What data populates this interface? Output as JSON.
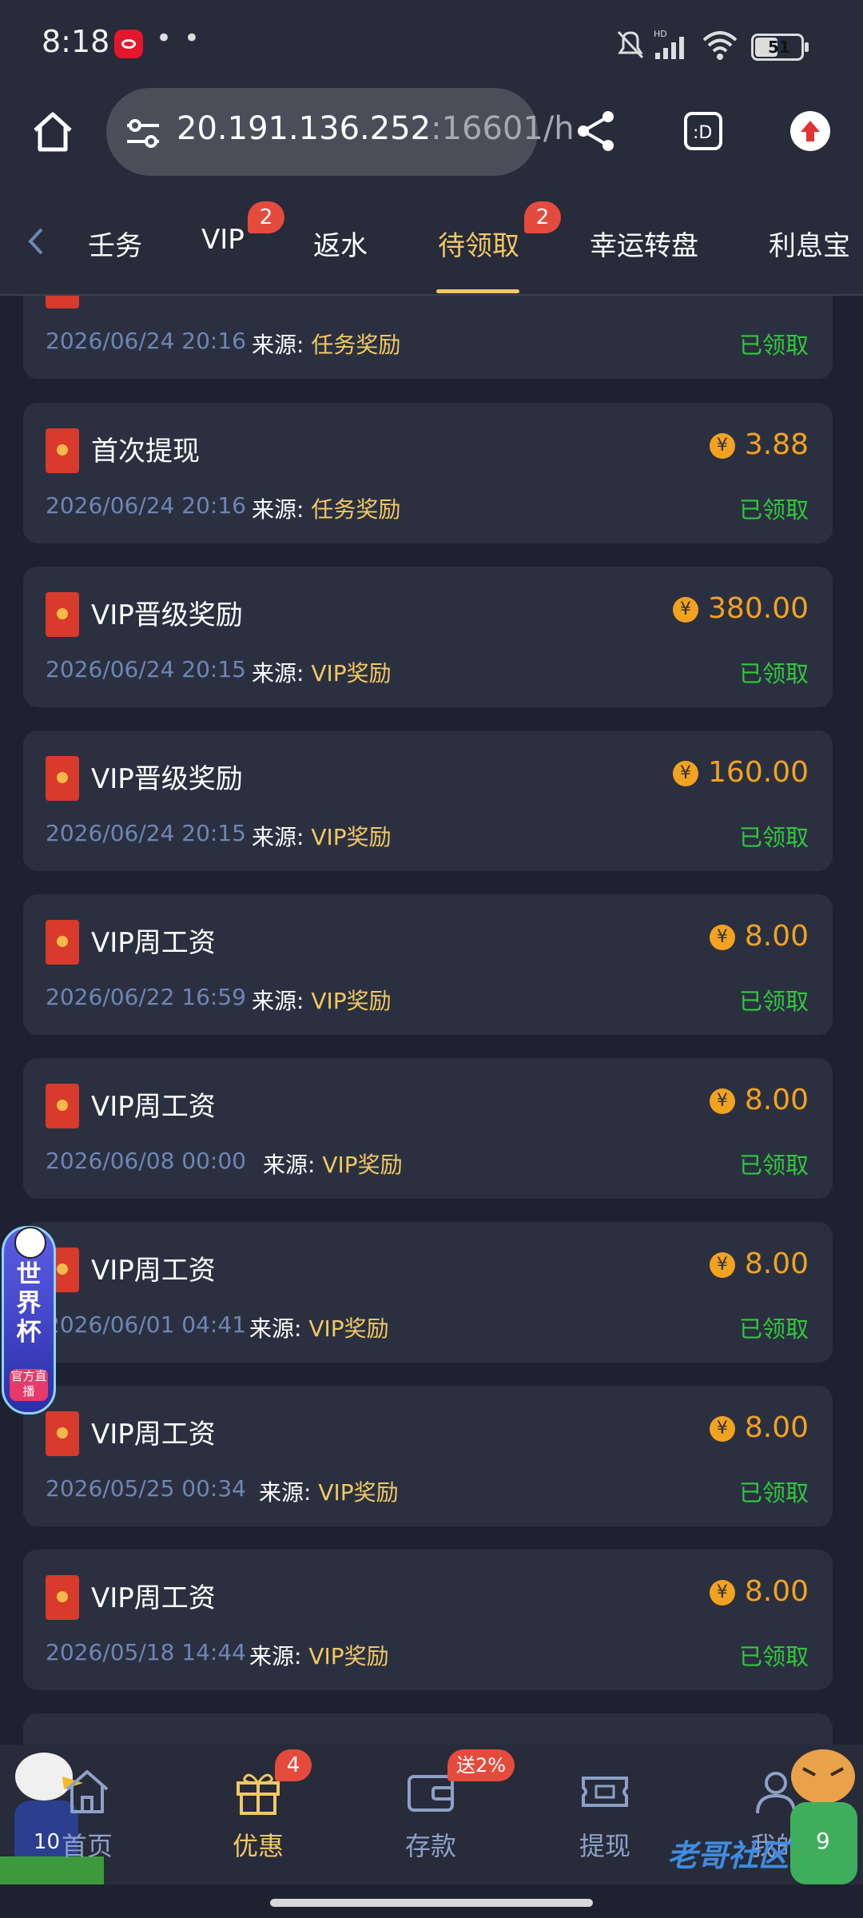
{
  "status_bar": {
    "time": "8:18",
    "battery": "51",
    "network": "HD"
  },
  "browser": {
    "url_host": "20.191.136.252",
    "url_rest": ":16601/h"
  },
  "tabs": [
    {
      "label": "任务",
      "display": "壬务"
    },
    {
      "label": "VIP",
      "badge": "2"
    },
    {
      "label": "返水"
    },
    {
      "label": "待领取",
      "badge": "2",
      "active": true
    },
    {
      "label": "幸运转盘"
    },
    {
      "label": "利息宝"
    }
  ],
  "records": [
    {
      "title": "",
      "amount": "",
      "date": "2026/06/24 20:16",
      "source_label": "来源:",
      "source": "任务奖励",
      "status": "已领取"
    },
    {
      "title": "首次提现",
      "amount": "3.88",
      "date": "2026/06/24 20:16",
      "source_label": "来源:",
      "source": "任务奖励",
      "status": "已领取"
    },
    {
      "title": "VIP晋级奖励",
      "amount": "380.00",
      "date": "2026/06/24 20:15",
      "source_label": "来源:",
      "source": "VIP奖励",
      "status": "已领取"
    },
    {
      "title": "VIP晋级奖励",
      "amount": "160.00",
      "date": "2026/06/24 20:15",
      "source_label": "来源:",
      "source": "VIP奖励",
      "status": "已领取"
    },
    {
      "title": "VIP周工资",
      "amount": "8.00",
      "date": "2026/06/22 16:59",
      "source_label": "来源:",
      "source": "VIP奖励",
      "status": "已领取"
    },
    {
      "title": "VIP周工资",
      "amount": "8.00",
      "date": "2026/06/08 00:00",
      "source_label": "来源:",
      "source": "VIP奖励",
      "status": "已领取"
    },
    {
      "title": "VIP周工资",
      "amount": "8.00",
      "date": "2026/06/01 04:41",
      "source_label": "来源:",
      "source": "VIP奖励",
      "status": "已领取"
    },
    {
      "title": "VIP周工资",
      "amount": "8.00",
      "date": "2026/05/25 00:34",
      "source_label": "来源:",
      "source": "VIP奖励",
      "status": "已领取"
    },
    {
      "title": "VIP周工资",
      "amount": "8.00",
      "date": "2026/05/18 14:44",
      "source_label": "来源:",
      "source": "VIP奖励",
      "status": "已领取"
    }
  ],
  "coin_symbol": "¥",
  "float_banner": {
    "title": "世界杯",
    "live": "官方直播"
  },
  "bottom_nav": [
    {
      "label": "首页"
    },
    {
      "label": "优惠",
      "badge": "4",
      "active": true
    },
    {
      "label": "存款",
      "badge": "送2%"
    },
    {
      "label": "提现"
    },
    {
      "label": "我的"
    }
  ],
  "watermark": "老哥社区",
  "colors": {
    "accent": "#f2c862",
    "amount": "#f3a21f",
    "claimed": "#32c83c",
    "badge": "#e54b3d",
    "background": "#1e2230",
    "card": "#2b3041"
  }
}
